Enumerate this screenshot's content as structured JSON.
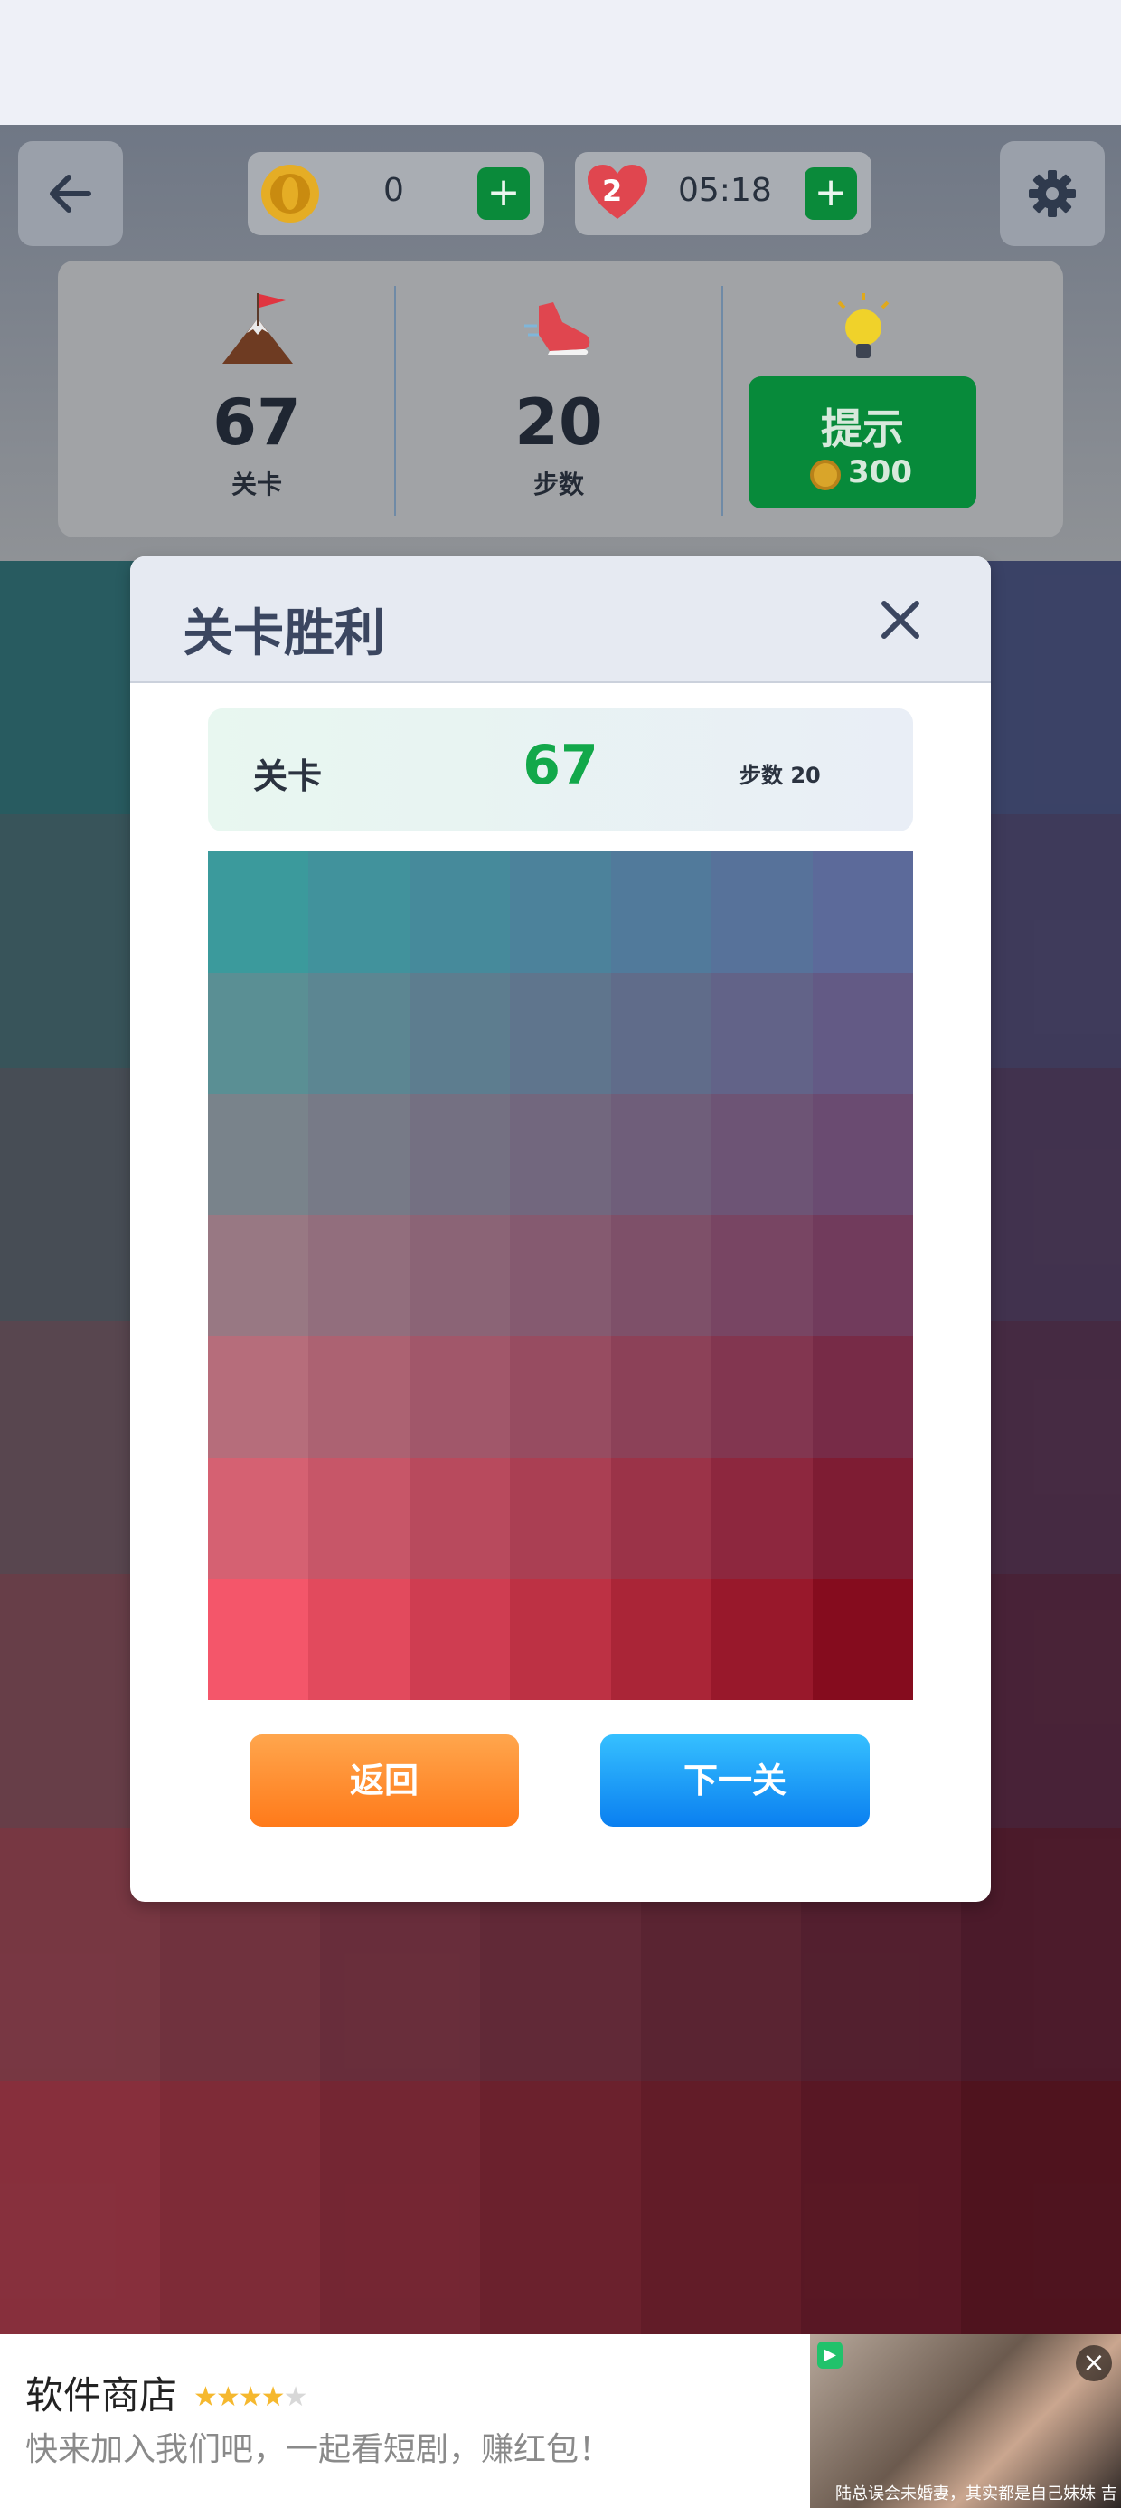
{
  "header": {
    "coins": "0",
    "lives": "2",
    "timer": "05:18",
    "add_symbol": "+"
  },
  "stats": {
    "level_value": "67",
    "level_label": "关卡",
    "steps_value": "20",
    "steps_label": "步数",
    "hint_label": "提示",
    "hint_cost": "300"
  },
  "icons": {
    "back": "arrow-left-icon",
    "coin": "coin-icon",
    "heart": "heart-icon",
    "settings": "gear-icon",
    "level": "mountain-flag-icon",
    "steps": "sneaker-icon",
    "hint": "lightbulb-icon",
    "close": "close-icon"
  },
  "modal": {
    "title": "关卡胜利",
    "level_label": "关卡",
    "level_value": "67",
    "steps_text": "步数 20",
    "back_button": "返回",
    "next_button": "下一关"
  },
  "board": {
    "rows": 7,
    "cols": 7,
    "top_left": "#3b9a9c",
    "top_right": "#5c6a9a",
    "bottom_left": "#f4566a",
    "bottom_right": "#850c1e"
  },
  "background_board": {
    "rows": 7,
    "cols": 7,
    "top_left": "#2f7d7f",
    "top_right": "#4b5688",
    "bottom_left": "#c03a48",
    "bottom_right": "#6a0e1a"
  },
  "ad": {
    "title": "软件商店",
    "subtitle": "快来加入我们吧，一起看短剧，赚红包！",
    "stars": "★★★★★",
    "rating": 4,
    "caption": "陆总误会未婚妻，其实都是自己妹妹 吉",
    "close_symbol": "×"
  },
  "colors": {
    "accent_green": "#078a3a",
    "level_green": "#12a84a",
    "orange_button": "#ff8a2a",
    "blue_button": "#1a9af8"
  }
}
